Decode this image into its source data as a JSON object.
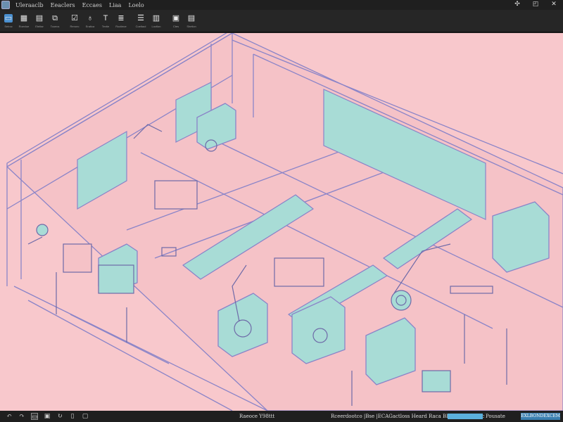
{
  "menubar": {
    "items": [
      "Uleraaclb",
      "Eeaclers",
      "Eccaes",
      "Liaa",
      "Loelo"
    ],
    "window_controls": [
      "✣",
      "◰",
      "✕"
    ]
  },
  "toolbar": {
    "tools": [
      {
        "icon": "pointer-icon",
        "glyph": "▭",
        "label": "Selroc"
      },
      {
        "icon": "grid-icon",
        "glyph": "▦",
        "label": "Roexloe"
      },
      {
        "icon": "layers-icon",
        "glyph": "▤",
        "label": "Eteltar"
      },
      {
        "icon": "duplicate-icon",
        "glyph": "⧉",
        "label": "Tooecs"
      },
      {
        "icon": "check-icon",
        "glyph": "☑",
        "label": "Reroec"
      },
      {
        "icon": "trace-icon",
        "glyph": "♁",
        "label": "Eratica"
      },
      {
        "icon": "text-icon",
        "glyph": "T",
        "label": "Tevtie"
      },
      {
        "icon": "align-icon",
        "glyph": "≣",
        "label": "Roctiece"
      },
      {
        "icon": "menu-icon",
        "glyph": "☰",
        "label": "Coeltaol"
      },
      {
        "icon": "table-icon",
        "glyph": "▥",
        "label": "Loctlon"
      },
      {
        "icon": "note-icon",
        "glyph": "▣",
        "label": "Ctes"
      },
      {
        "icon": "panel-icon",
        "glyph": "▤",
        "label": "Sheticn"
      }
    ]
  },
  "statusbar": {
    "icons": [
      {
        "name": "undo-icon",
        "glyph": "↶"
      },
      {
        "name": "redo-icon",
        "glyph": "↷"
      },
      {
        "name": "frame-icon",
        "glyph": "▭"
      },
      {
        "name": "save-icon",
        "glyph": "▣"
      },
      {
        "name": "refresh-icon",
        "glyph": "↻"
      },
      {
        "name": "delete-icon",
        "glyph": "▯"
      },
      {
        "name": "window-icon",
        "glyph": "▢"
      }
    ],
    "coordinates": "Raeoce Y98ttt",
    "info": "Rceerdootco |Bse |ECAGactloss Heard Raca Bleetec: | Bsatec",
    "progress": 1.0,
    "mode": "Pousate",
    "zoom": "EXLBONDEXCEM"
  },
  "colors": {
    "viewport_bg": "#f8c8cc",
    "line": "#8a84c8",
    "fill": "#a8dcd6",
    "accent": "#4a90d0"
  }
}
